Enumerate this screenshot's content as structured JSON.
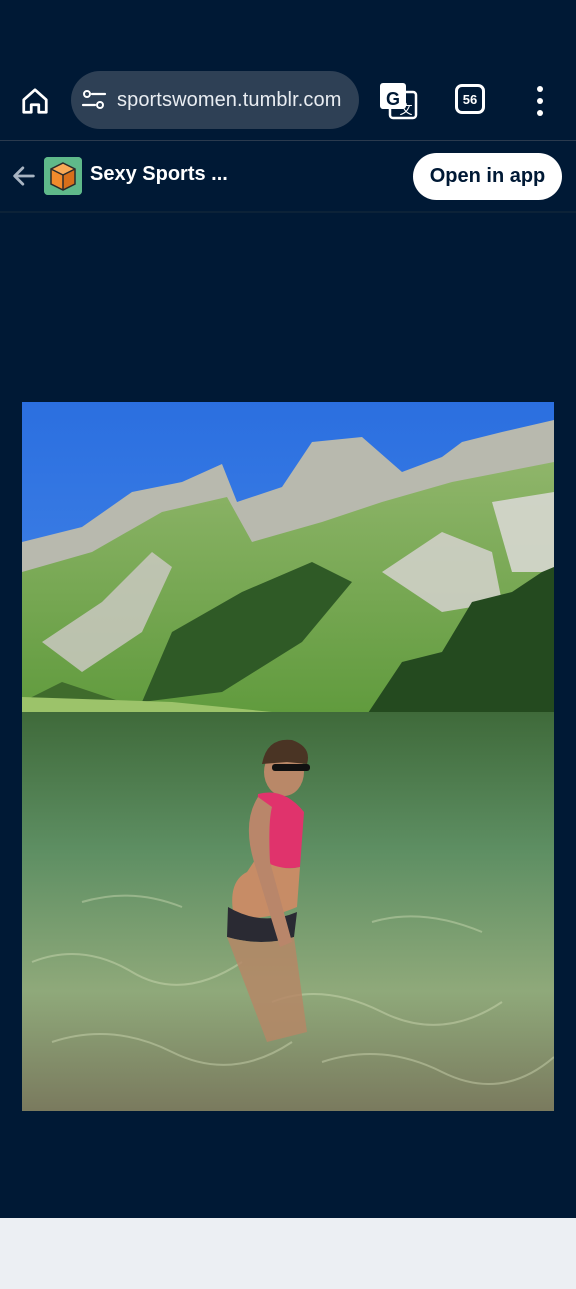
{
  "browser": {
    "url": "sportswomen.tumblr.com",
    "tab_count": "56",
    "icons": {
      "home": "home-icon",
      "site_settings": "tune-icon",
      "translate": "translate-icon",
      "tabs": "tab-switcher-icon",
      "menu": "more-vert-icon"
    }
  },
  "tumblr": {
    "blog_name": "Sexy Sports ...",
    "open_in_app_label": "Open in app",
    "icons": {
      "back": "back-arrow-icon",
      "avatar": "blog-avatar-icon"
    }
  },
  "post": {
    "image_description_icon": "post-photo"
  },
  "colors": {
    "background": "#001935",
    "url_pill": "#2e4055",
    "button_bg": "#ffffff",
    "bottom_bar": "#eceff3"
  }
}
